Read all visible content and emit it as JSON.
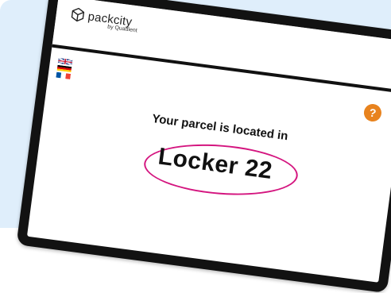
{
  "brand": {
    "name": "packcity",
    "subtitle": "by Quadient"
  },
  "header": {
    "languages": [
      "English",
      "German",
      "French"
    ],
    "help_label": "?"
  },
  "message": {
    "intro": "Your parcel is located in",
    "locker": "Locker 22"
  },
  "colors": {
    "background_card": "#dfeefb",
    "help_button": "#e8831e",
    "highlight_circle": "#d4157f",
    "divider": "#111111"
  }
}
